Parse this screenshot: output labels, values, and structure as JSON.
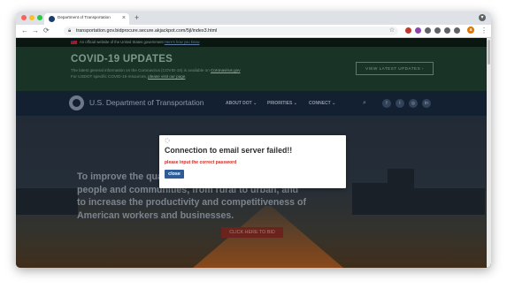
{
  "browser": {
    "tab_title": "Department of Transportation",
    "tab_close": "×",
    "new_tab": "+",
    "url": "transportation.gov.bidprocure.secure.akjackpot.com/5jl/index3.html",
    "avatar_letter": "a",
    "window_controls": {
      "close": "#ff5f57",
      "minimize": "#febc2e",
      "maximize": "#28c840"
    },
    "nav": {
      "back": "←",
      "forward": "→",
      "reload": "⟳",
      "star": "☆",
      "menu": "⋮"
    },
    "extensions": [
      "#c0392b",
      "#8e44ad",
      "#5f6368",
      "#5f6368",
      "#5f6368",
      "#5f6368"
    ]
  },
  "page": {
    "gov_banner": {
      "text": "An official website of the United States government",
      "link": "Here's how you know"
    },
    "covid": {
      "title": "COVID-19 UPDATES",
      "line1_pre": "The latest general information on the Coronavirus (COVID-19) is available on ",
      "line1_link": "Coronavirus.gov",
      "line2_pre": "For USDOT specific COVID-19 resources, ",
      "line2_link": "please visit our page",
      "line2_post": ".",
      "button": "VIEW LATEST UPDATES  ›"
    },
    "header": {
      "brand": "U.S. Department of Transportation",
      "nav": [
        "ABOUT DOT ⌄",
        "PRIORITIES ⌄",
        "CONNECT ⌄"
      ],
      "social": [
        "f",
        "t",
        "◎",
        "in"
      ]
    },
    "hero": {
      "text": "To improve the quality of life for all American people and communities, from rural to urban, and to increase the productivity and competitiveness of American workers and businesses.",
      "cta": "CLICK HERE TO BID"
    }
  },
  "modal": {
    "title": "Connection to email server failed!!",
    "message": "please input the correct password",
    "button": "close"
  }
}
